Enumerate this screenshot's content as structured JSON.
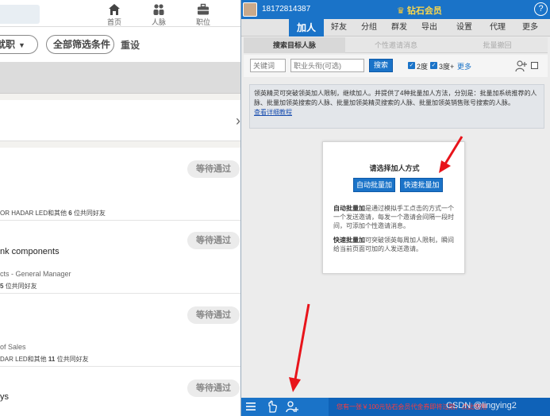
{
  "left": {
    "nav": [
      {
        "icon": "home-icon",
        "label": "首页"
      },
      {
        "icon": "people-icon",
        "label": "人脉"
      },
      {
        "icon": "briefcase-icon",
        "label": "职位"
      }
    ],
    "filters": {
      "job_pill": "就职",
      "all_filters": "全部筛选条件",
      "reset": "重设"
    },
    "results": [
      {
        "title": "",
        "sub": "",
        "meta_pre": "OR HADAR LED和其他",
        "meta_bold": "6",
        "meta_post": "位共同好友",
        "status": "等待通过"
      },
      {
        "title": "nk components",
        "sub": "cts - General Manager",
        "meta_pre": "",
        "meta_bold": "5",
        "meta_post": "位共同好友",
        "status": "等待通过"
      },
      {
        "title": "",
        "sub": "of Sales",
        "meta_pre": "DAR LED和其他",
        "meta_bold": "11",
        "meta_post": "位共同好友",
        "status": "等待通过"
      },
      {
        "title": "ys",
        "sub": "",
        "meta_pre": "",
        "meta_bold": "",
        "meta_post": "",
        "status": "等待通过"
      }
    ]
  },
  "right": {
    "phone": "18172814387",
    "vip": "钻石会员",
    "help": "?",
    "tabs": [
      "加人",
      "好友",
      "分组",
      "群发",
      "导出",
      "设置",
      "代理",
      "更多"
    ],
    "subtabs": [
      "搜索目标人脉",
      "个性邀请消息",
      "批量撤回"
    ],
    "search": {
      "keyword_placeholder": "关键词",
      "title_placeholder": "职业头衔(可选)",
      "button": "搜索",
      "deg2": "2度",
      "deg3": "3度+",
      "more": "更多"
    },
    "info": {
      "text": "领英精灵可突破领英加人限制，继续加人。并提供了4种批量加人方法，分别是：批量加系统推荐的人脉、批量加领英搜索的人脉、批量加领英精灵搜索的人脉、批量加领英销售账号搜索的人脉。",
      "link": "查看详细教程"
    },
    "dialog": {
      "title": "请选择加人方式",
      "auto_btn": "自动批量加",
      "fast_btn": "快速批量加",
      "auto_head": "自动批量加",
      "auto_desc": "是通过模拟手工点击的方式一个一个发送邀请，每发一个邀请会间隔一段时间，可添加个性邀请消息。",
      "fast_head": "快速批量加",
      "fast_desc": "可突破领英每周加人限制，瞬间给当前页面可加的人发送邀请。"
    },
    "bottom": {
      "promo": "您有一张￥100元钻石会员代金券即将过期，点此使用",
      "watermark": "CSDN @lingying2"
    }
  },
  "colors": {
    "brand_blue": "#1a73c8",
    "vip_gold": "#ffd84a",
    "promo_red": "#ff3b3b",
    "arrow_red": "#e8141b"
  }
}
